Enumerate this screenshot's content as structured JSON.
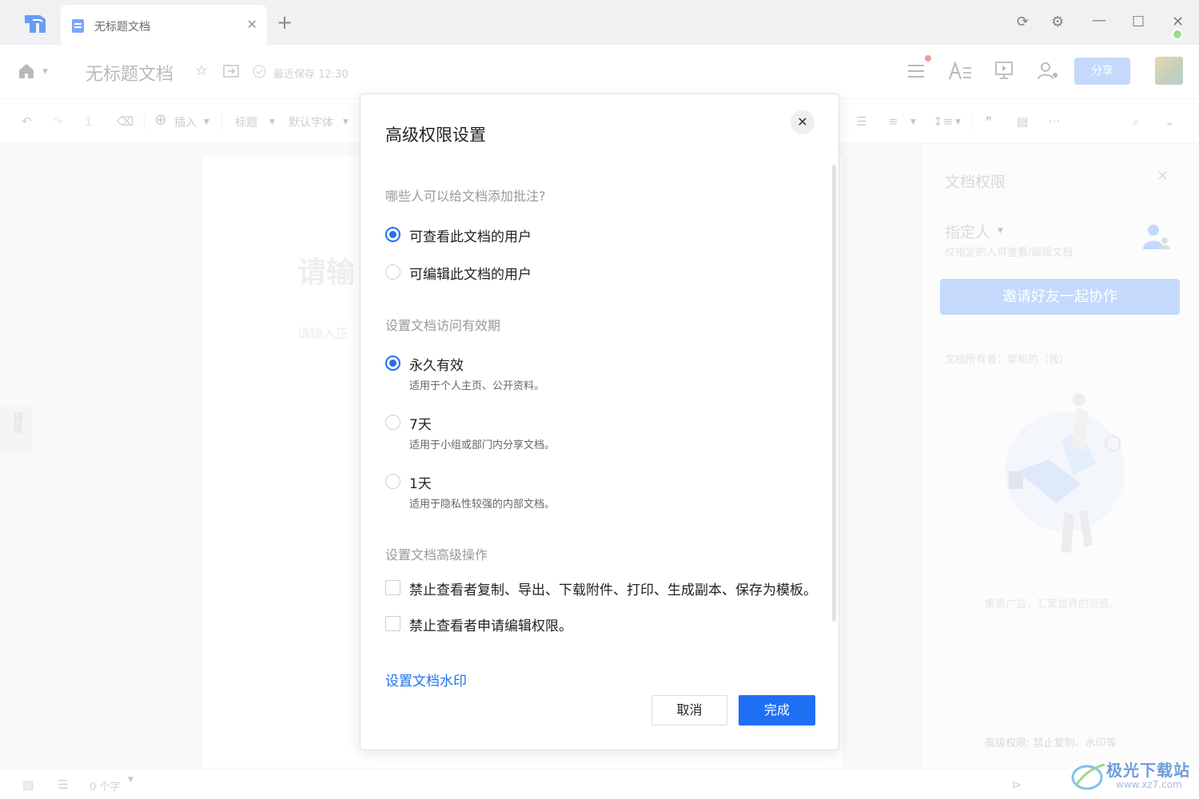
{
  "titlebar": {
    "tab_title": "无标题文档",
    "new_tab": "+",
    "tab_close": "✕",
    "refresh": "⟳",
    "settings": "⚙",
    "minimize": "—",
    "maximize": "☐",
    "close": "✕"
  },
  "header": {
    "doc_title": "无标题文档",
    "saved_status": "最近保存 12:30",
    "share_label": "分享"
  },
  "toolbar": {
    "insert_label": "插入",
    "heading_label": "标题",
    "font_label": "默认字体"
  },
  "canvas": {
    "title_placeholder": "请输",
    "body_placeholder": "请输入正",
    "toc_label": "目录"
  },
  "right_panel": {
    "title": "文档权限",
    "permission_mode": "指定人",
    "permission_desc": "仅指定的人可查看/编辑文档",
    "invite_label": "邀请好友一起协作",
    "owner_text": "文档所有者：掌柜的（我）",
    "slogan": "集思广益，汇集世界的灵感。",
    "advanced_hint": "高级权限: 禁止复制、水印等"
  },
  "statusbar": {
    "word_count": "0 个字"
  },
  "dialog": {
    "title": "高级权限设置",
    "close": "✕",
    "comment_section": "哪些人可以给文档添加批注?",
    "comment_options": [
      {
        "label": "可查看此文档的用户",
        "checked": true
      },
      {
        "label": "可编辑此文档的用户",
        "checked": false
      }
    ],
    "validity_section": "设置文档访问有效期",
    "validity_options": [
      {
        "label": "永久有效",
        "desc": "适用于个人主页、公开资料。",
        "checked": true
      },
      {
        "label": "7天",
        "desc": "适用于小组或部门内分享文档。",
        "checked": false
      },
      {
        "label": "1天",
        "desc": "适用于隐私性较强的内部文档。",
        "checked": false
      }
    ],
    "advanced_section": "设置文档高级操作",
    "advanced_options": [
      {
        "label": "禁止查看者复制、导出、下载附件、打印、生成副本、保存为模板。",
        "checked": false
      },
      {
        "label": "禁止查看者申请编辑权限。",
        "checked": false
      }
    ],
    "watermark_link": "设置文档水印",
    "cancel_label": "取消",
    "done_label": "完成"
  },
  "site_watermark": {
    "name": "极光下载站",
    "url": "www.xz7.com"
  },
  "colors": {
    "accent": "#1f6ff5",
    "share_button": "#a8c8fb",
    "title_bar": "#e9eaec"
  }
}
